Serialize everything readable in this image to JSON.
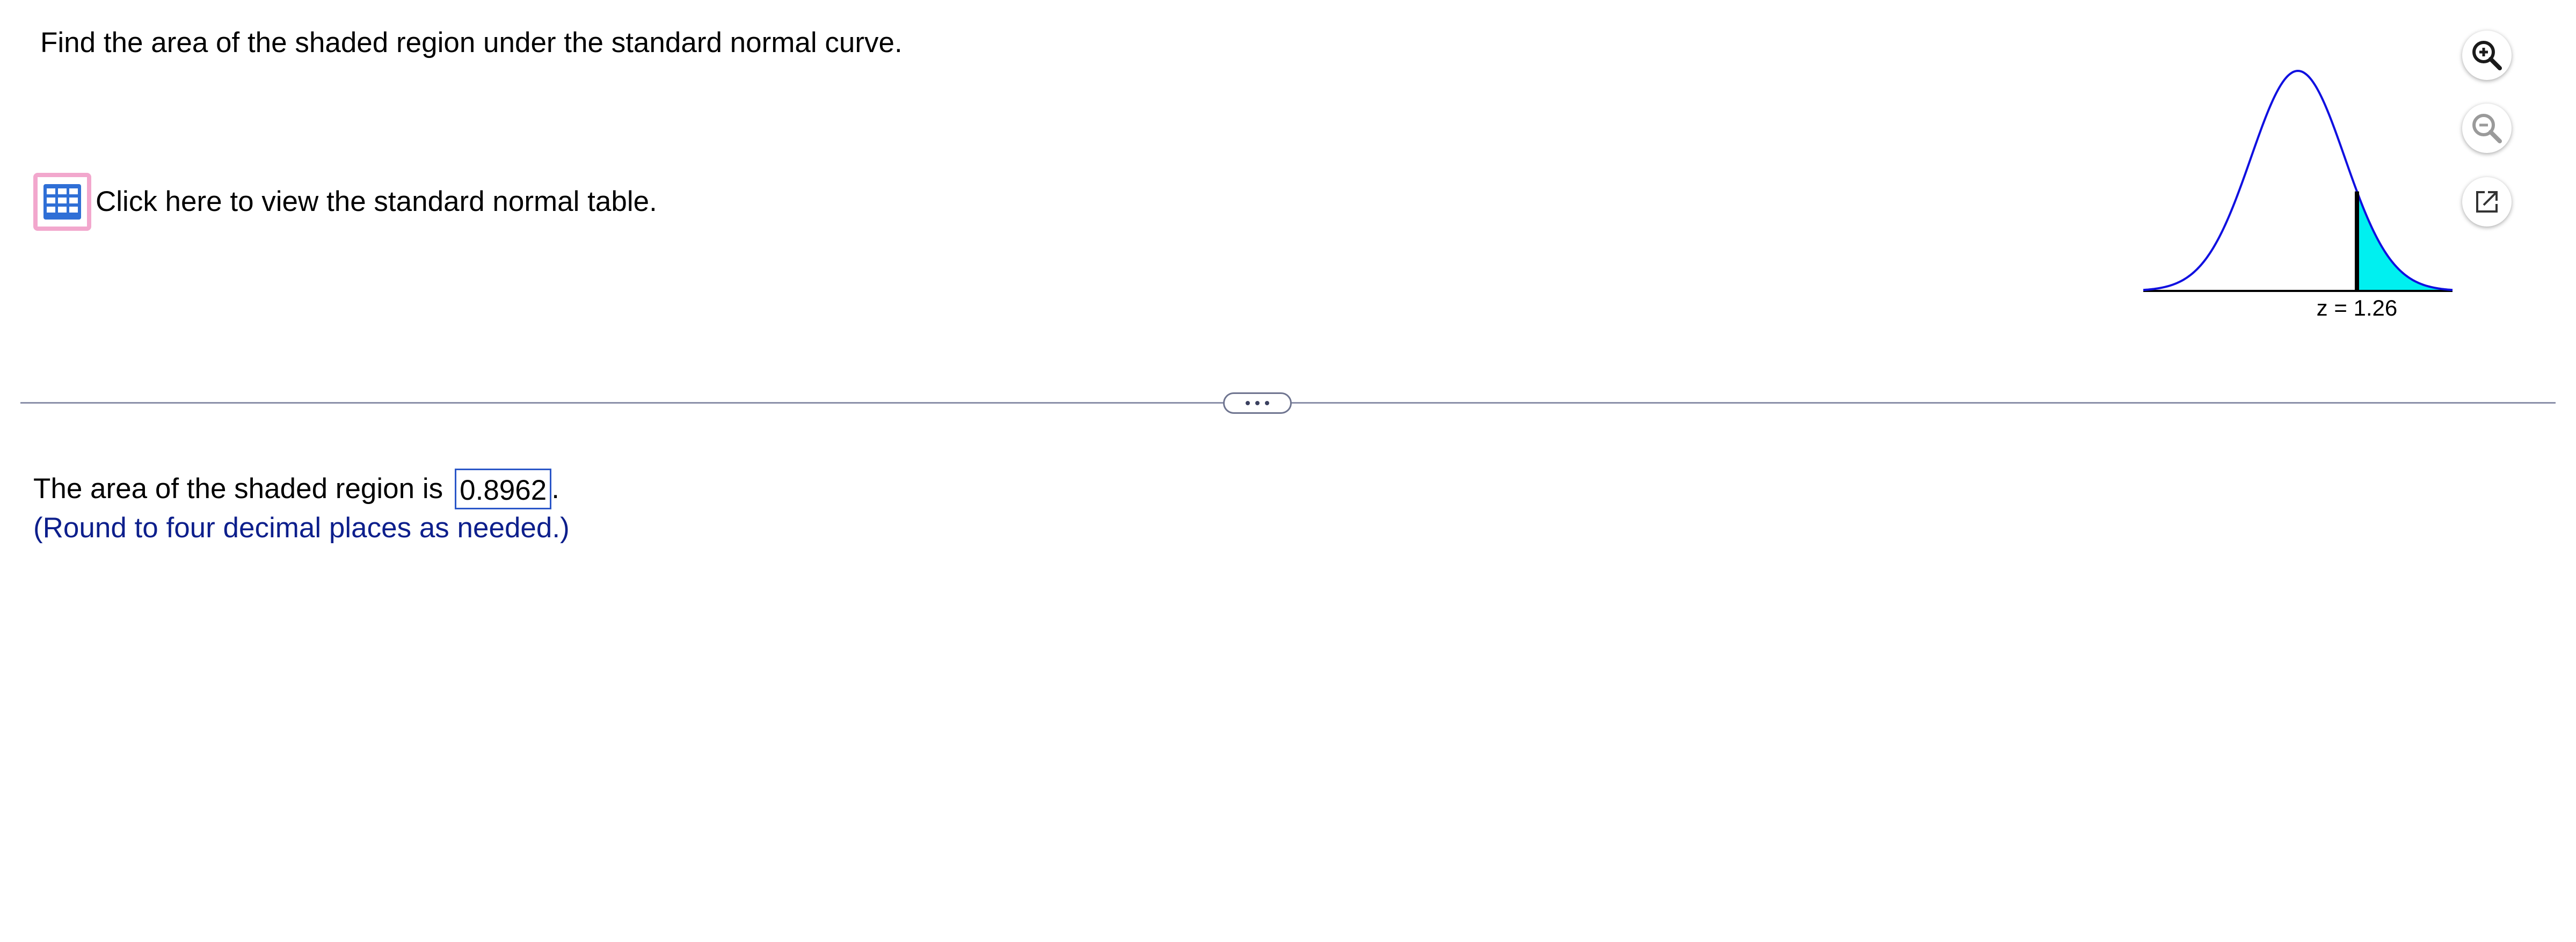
{
  "question": {
    "prompt": "Find the area of the shaded region under the standard normal curve."
  },
  "table_link": {
    "icon": "table-grid-icon",
    "label": "Click here to view the standard normal table."
  },
  "graph": {
    "z_label": "z = 1.26",
    "z_value": 1.26,
    "shaded_side": "right",
    "curve_color": "#1010e0",
    "shade_color": "#00f0f0"
  },
  "tools": {
    "zoom_in_icon": "zoom-in-icon",
    "zoom_out_icon": "zoom-out-icon",
    "popout_icon": "popout-icon"
  },
  "answer": {
    "prefix": "The area of the shaded region is",
    "value": "0.8962",
    "suffix": ".",
    "hint": "(Round to four decimal places as needed.)"
  },
  "colors": {
    "divider": "#8a8fa8",
    "answer_border": "#2b57c8",
    "hint": "#0d1f8c",
    "icon_border": "#f2a7cd",
    "icon_fill": "#2f6fd6"
  }
}
